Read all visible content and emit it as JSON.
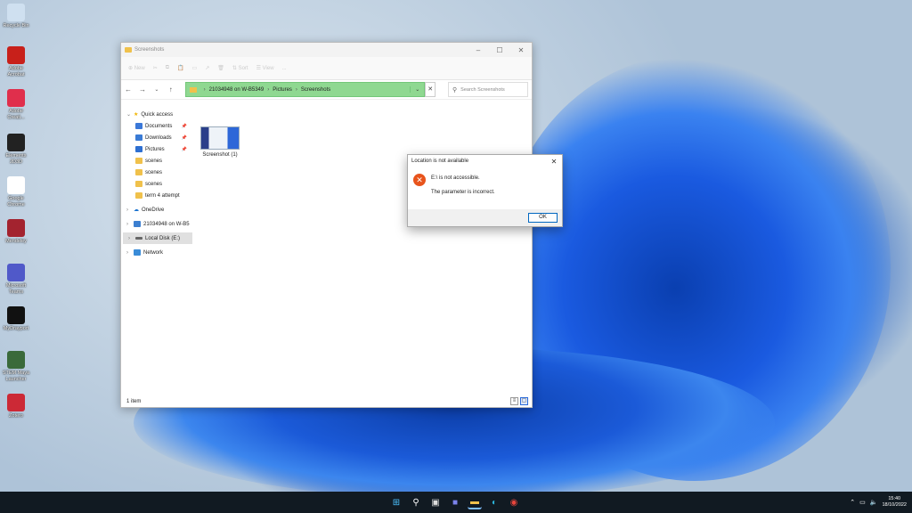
{
  "desktop": {
    "icons": [
      {
        "label": "Recycle Bin",
        "color": "#cfe0f0"
      },
      {
        "label": "Adobe Acrobat",
        "color": "#c8201a"
      },
      {
        "label": "Adobe Creati...",
        "color": "#e02f4c"
      },
      {
        "label": "Elements 2D3D",
        "color": "#222222"
      },
      {
        "label": "Google Chrome",
        "color": "#ffffff"
      },
      {
        "label": "Mendeley",
        "color": "#a3232f"
      },
      {
        "label": "Microsoft Teams",
        "color": "#5059c9"
      },
      {
        "label": "MyDrayport",
        "color": "#111111"
      },
      {
        "label": "STEM Maya Launcher",
        "color": "#3a6a3a"
      },
      {
        "label": "Zotero",
        "color": "#cc2936"
      }
    ]
  },
  "explorer": {
    "title": "Screenshots",
    "toolbar": [
      "New",
      "",
      "",
      "",
      "",
      "",
      "Sort",
      "View",
      "..."
    ],
    "address": {
      "segments": [
        "21034948 on W-B5349",
        "Pictures",
        "Screenshots"
      ]
    },
    "search_placeholder": "Search Screenshots",
    "nav": {
      "quick_access": "Quick access",
      "items": [
        {
          "label": "Documents",
          "pinned": true
        },
        {
          "label": "Downloads",
          "pinned": true
        },
        {
          "label": "Pictures",
          "pinned": true
        },
        {
          "label": "scenes",
          "pinned": false
        },
        {
          "label": "scenes",
          "pinned": false
        },
        {
          "label": "scenes",
          "pinned": false
        },
        {
          "label": "term 4 attempt",
          "pinned": false
        }
      ],
      "onedrive": "OneDrive",
      "network_drive": "21034948 on W-B5",
      "local_disk": "Local Disk (E:)",
      "network": "Network"
    },
    "file": {
      "name": "Screenshot (1)"
    },
    "status": "1 item"
  },
  "dialog": {
    "title": "Location is not available",
    "message1": "E:\\ is not accessible.",
    "message2": "The parameter is incorrect.",
    "ok_label": "OK"
  },
  "taskbar": {
    "time": "15:40",
    "date": "18/10/2022"
  },
  "colors": {
    "address_highlight": "#8fd891",
    "error_icon": "#e8541c",
    "taskbar": "#111a22"
  }
}
